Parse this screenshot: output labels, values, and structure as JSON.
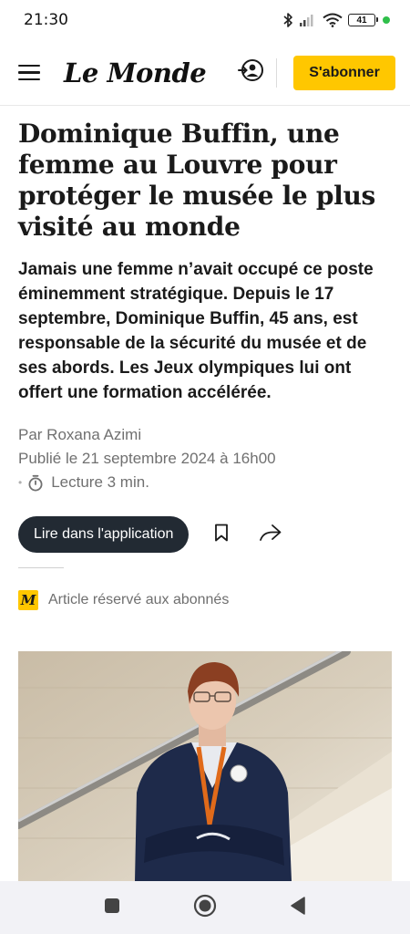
{
  "status_bar": {
    "time": "21:30",
    "battery_level": "41",
    "icons": [
      "bluetooth-icon",
      "signal-icon",
      "wifi-icon",
      "battery-icon"
    ]
  },
  "header": {
    "logo": "Le Monde",
    "account_icon": "account-login-icon",
    "subscribe_label": "S'abonner",
    "accent_color": "#ffc700"
  },
  "article": {
    "headline": "Dominique Buffin, une femme au Louvre pour protéger le musée le plus visité au monde",
    "standfirst": "Jamais une femme n’avait occupé ce poste éminemment stratégique. Depuis le 17 septembre, Dominique Buffin, 45 ans, est responsable de la sécurité du musée et de ses abords. Les Jeux olympiques lui ont offert une formation accélérée.",
    "author": "Par Roxana Azimi",
    "published": "Publié le 21 septembre 2024 à 16h00",
    "reading_time": "Lecture 3 min.",
    "app_button_label": "Lire dans l'application",
    "subscriber_badge": "M",
    "subscriber_note": "Article réservé aux abonnés"
  },
  "navbar": {
    "icons": [
      "recent-apps-icon",
      "home-icon",
      "back-icon"
    ]
  }
}
